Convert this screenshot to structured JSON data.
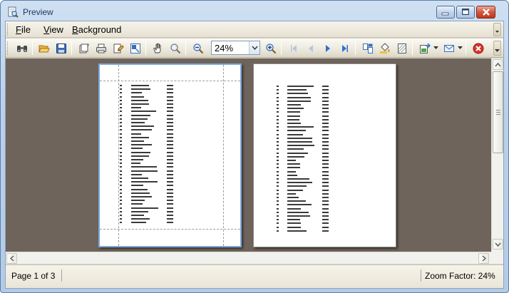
{
  "window": {
    "title": "Preview"
  },
  "menu": {
    "items": [
      {
        "underline": "F",
        "rest": "ile"
      },
      {
        "underline": "V",
        "rest": "iew"
      },
      {
        "underline": "B",
        "rest": "ackground"
      }
    ]
  },
  "toolbar": {
    "zoom_value": "24%",
    "buttons": [
      "find-icon",
      "open-icon",
      "save-icon",
      "page-setup-icon",
      "print-icon",
      "print-direct-icon",
      "scale-icon",
      "hand-tool-icon",
      "magnifier-icon",
      "zoom-out-icon",
      "zoom-in-icon",
      "first-page-icon",
      "previous-page-icon",
      "next-page-icon",
      "last-page-icon",
      "multiple-pages-icon",
      "fill-background-icon",
      "watermark-icon",
      "export-icon",
      "send-email-icon",
      "close-preview-icon"
    ]
  },
  "status": {
    "page": "Page 1 of 3",
    "zoom": "Zoom Factor: 24%"
  },
  "colors": {
    "viewport": "#6f645b",
    "selected_page_border": "#7aa9de",
    "close_button": "#d5553d"
  }
}
